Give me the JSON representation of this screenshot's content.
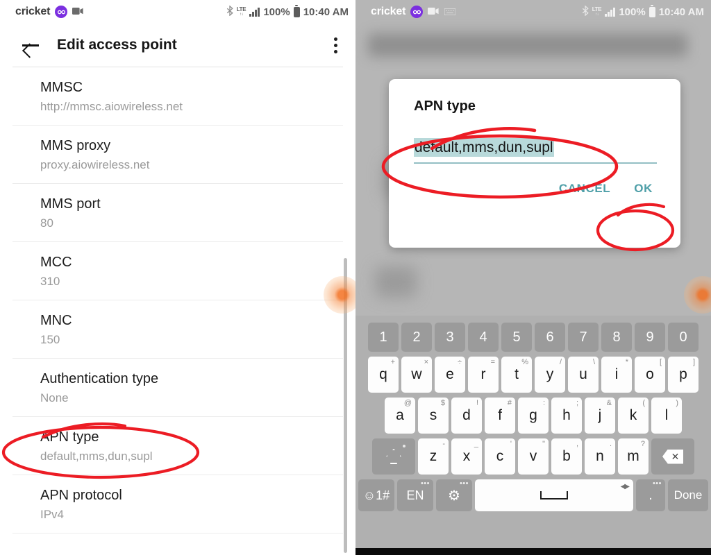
{
  "status_bar": {
    "carrier": "cricket",
    "logo_glyph": "∞",
    "icons": [
      "video-camera",
      "keyboard"
    ],
    "bluetooth_glyph": "✻",
    "lte_label": "LTE",
    "lte_arrows": "↑↓",
    "battery_percent": "100%",
    "time": "10:40 AM"
  },
  "left_panel": {
    "toolbar": {
      "title": "Edit access point",
      "back_icon": "back-arrow-icon",
      "overflow_icon": "overflow-menu-icon"
    },
    "settings": [
      {
        "title": "MMSC",
        "value": "http://mmsc.aiowireless.net"
      },
      {
        "title": "MMS proxy",
        "value": "proxy.aiowireless.net"
      },
      {
        "title": "MMS port",
        "value": "80"
      },
      {
        "title": "MCC",
        "value": "310"
      },
      {
        "title": "MNC",
        "value": "150"
      },
      {
        "title": "Authentication type",
        "value": "None"
      },
      {
        "title": "APN type",
        "value": "default,mms,dun,supl"
      },
      {
        "title": "APN protocol",
        "value": "IPv4"
      }
    ],
    "annotation": {
      "target": "APN type",
      "color": "#ec1c24",
      "shape": "hand-drawn-ellipse"
    }
  },
  "right_panel": {
    "dialog": {
      "title": "APN type",
      "field_value": "default,mms,dun,supl",
      "field_selected": true,
      "cancel_label": "CANCEL",
      "ok_label": "OK",
      "accent_color": "#4e9fa8",
      "selection_color": "#b8d9da"
    },
    "annotations": [
      {
        "target": "field_value",
        "color": "#ec1c24",
        "shape": "hand-drawn-ellipse"
      },
      {
        "target": "ok_button",
        "color": "#ec1c24",
        "shape": "hand-drawn-ellipse"
      }
    ],
    "keyboard": {
      "row_numbers": [
        "1",
        "2",
        "3",
        "4",
        "5",
        "6",
        "7",
        "8",
        "9",
        "0"
      ],
      "row_top": [
        {
          "key": "q",
          "sub": "+"
        },
        {
          "key": "w",
          "sub": "×"
        },
        {
          "key": "e",
          "sub": "÷"
        },
        {
          "key": "r",
          "sub": "="
        },
        {
          "key": "t",
          "sub": "%"
        },
        {
          "key": "y",
          "sub": "/"
        },
        {
          "key": "u",
          "sub": "\\"
        },
        {
          "key": "i",
          "sub": "*"
        },
        {
          "key": "o",
          "sub": "["
        },
        {
          "key": "p",
          "sub": "]"
        }
      ],
      "row_home": [
        {
          "key": "a",
          "sub": "@"
        },
        {
          "key": "s",
          "sub": "$"
        },
        {
          "key": "d",
          "sub": "!"
        },
        {
          "key": "f",
          "sub": "#"
        },
        {
          "key": "g",
          "sub": ":"
        },
        {
          "key": "h",
          "sub": ";"
        },
        {
          "key": "j",
          "sub": "&"
        },
        {
          "key": "k",
          "sub": "("
        },
        {
          "key": "l",
          "sub": ")"
        }
      ],
      "row_bottom": [
        {
          "key": "z",
          "sub": "-"
        },
        {
          "key": "x",
          "sub": "_"
        },
        {
          "key": "c",
          "sub": "'"
        },
        {
          "key": "v",
          "sub": "\""
        },
        {
          "key": "b",
          "sub": ","
        },
        {
          "key": "n",
          "sub": "."
        },
        {
          "key": "m",
          "sub": "?"
        }
      ],
      "shift_label": "shift-icon",
      "backspace_label": "✕",
      "symbols_label": "☺1#",
      "language_label": "EN",
      "settings_label": "⚙",
      "space_label": "space-bar",
      "period_label": ".",
      "done_label": "Done"
    }
  }
}
